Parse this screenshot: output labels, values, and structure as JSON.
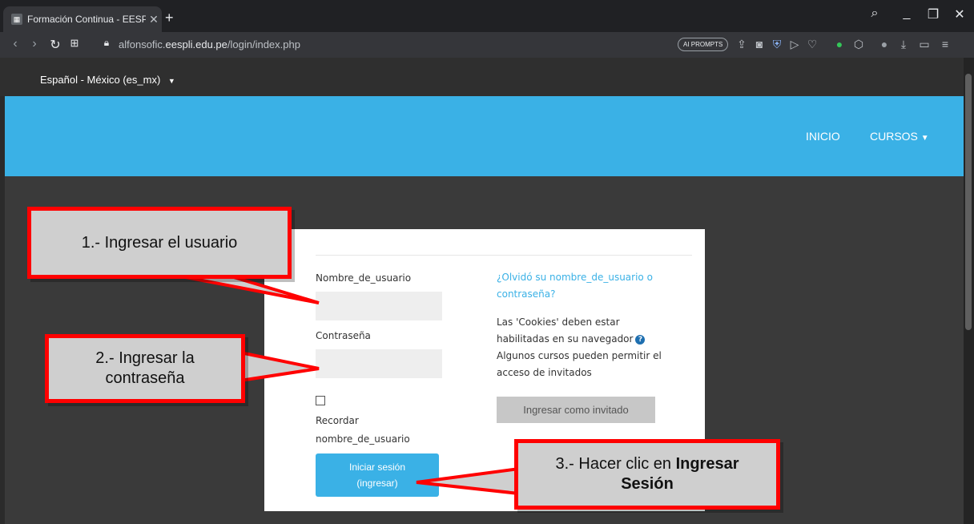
{
  "browser": {
    "tab_title": "Formación Continua - EESP",
    "url_prefix": "alfonsofic.",
    "url_domain": "eespli.edu.pe",
    "url_path": "/login/index.php",
    "ai_badge": "AI PROMPTS"
  },
  "lang": {
    "selected": "Español - México (es_mx)"
  },
  "nav": {
    "inicio": "INICIO",
    "cursos": "CURSOS"
  },
  "login": {
    "username_label": "Nombre_de_usuario",
    "password_label": "Contraseña",
    "remember_label_1": "Recordar",
    "remember_label_2": "nombre_de_usuario",
    "login_button_1": "Iniciar sesión",
    "login_button_2": "(ingresar)",
    "forgot_link_1": "¿Olvidó su nombre_de_usuario o",
    "forgot_link_2": "contraseña?",
    "cookies_1": "Las 'Cookies' deben estar",
    "cookies_2": "habilitadas en su navegador",
    "guests_1": "Algunos cursos pueden permitir el",
    "guests_2": "acceso de invitados",
    "guest_button": "Ingresar como invitado"
  },
  "callouts": {
    "c1": "1.- Ingresar el usuario",
    "c2_1": "2.- Ingresar la",
    "c2_2": "contraseña",
    "c3_1": "3.- Hacer clic en ",
    "c3_bold": "Ingresar",
    "c3_2": "Sesión"
  },
  "colors": {
    "accent": "#3ab1e6",
    "callout_border": "#ff0000"
  }
}
